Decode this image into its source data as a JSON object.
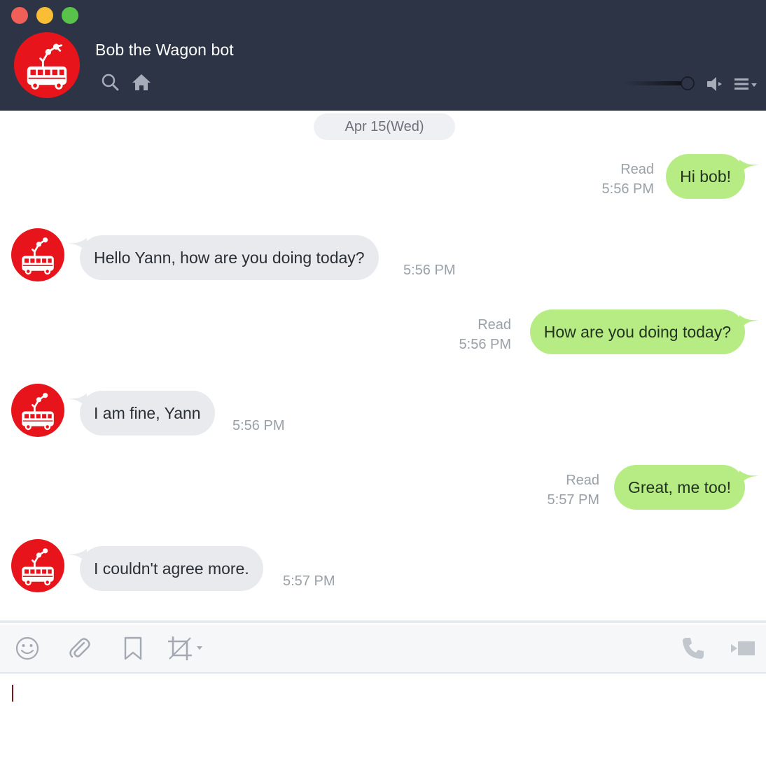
{
  "window": {
    "controls": [
      "close",
      "minimize",
      "maximize"
    ]
  },
  "header": {
    "title": "Bob the Wagon bot",
    "avatar_icon": "robot-arm-bus-logo",
    "icons": [
      "search-icon",
      "home-icon",
      "speaker-icon",
      "menu-icon"
    ],
    "volume_level": 0.8
  },
  "chat": {
    "date_label": "Apr 15(Wed)",
    "messages": [
      {
        "direction": "outgoing",
        "text": "Hi bob!",
        "status": "Read",
        "time": "5:56 PM"
      },
      {
        "direction": "incoming",
        "text": "Hello Yann, how are you doing today?",
        "time": "5:56 PM"
      },
      {
        "direction": "outgoing",
        "text": "How are you doing today?",
        "status": "Read",
        "time": "5:56 PM"
      },
      {
        "direction": "incoming",
        "text": "I am fine, Yann",
        "time": "5:56 PM"
      },
      {
        "direction": "outgoing",
        "text": "Great, me too!",
        "status": "Read",
        "time": "5:57 PM"
      },
      {
        "direction": "incoming",
        "text": "I couldn't agree more.",
        "time": "5:57 PM"
      }
    ]
  },
  "toolbar": {
    "icons": [
      "emoji-icon",
      "paperclip-icon",
      "bookmark-icon",
      "crop-icon",
      "phone-icon",
      "video-icon"
    ]
  },
  "composer": {
    "value": ""
  },
  "colors": {
    "header_bg": "#2c3446",
    "outgoing_bubble": "#b7ec85",
    "incoming_bubble": "#e8eaee",
    "avatar_red": "#e8141c"
  }
}
